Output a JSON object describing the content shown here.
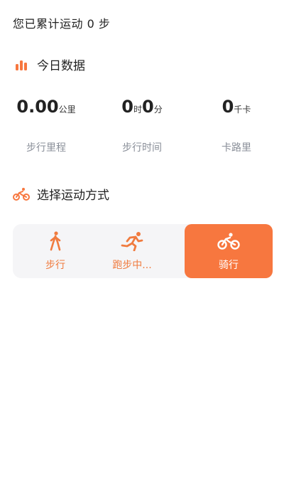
{
  "header": {
    "total_steps_text": "您已累计运动 0 步"
  },
  "today": {
    "title": "今日数据",
    "icon": "bar-chart-icon",
    "distance": {
      "value": "0.00",
      "unit": "公里",
      "label": "步行里程"
    },
    "time": {
      "hours": "0",
      "hours_unit": "时",
      "minutes": "0",
      "minutes_unit": "分",
      "label": "步行时间"
    },
    "calories": {
      "value": "0",
      "unit": "千卡",
      "label": "卡路里"
    }
  },
  "modes": {
    "title": "选择运动方式",
    "icon": "bicycle-icon",
    "items": [
      {
        "label": "步行",
        "icon": "walk-icon",
        "selected": false
      },
      {
        "label": "跑步中...",
        "icon": "run-icon",
        "selected": false
      },
      {
        "label": "骑行",
        "icon": "bicycle-icon",
        "selected": true
      }
    ]
  },
  "colors": {
    "accent": "#f7773f",
    "label_gray": "#8a8f99",
    "panel_bg": "#f5f5f7"
  }
}
